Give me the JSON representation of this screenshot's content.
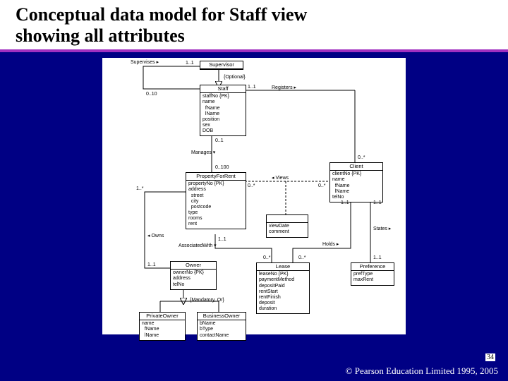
{
  "title_line1": "Conceptual data model for Staff view",
  "title_line2": "showing all attributes",
  "page_number": "34",
  "copyright": "© Pearson Education Limited 1995, 2005",
  "entities": {
    "supervisor": {
      "name": "Supervisor"
    },
    "staff": {
      "name": "Staff",
      "attrs": "staffNo {PK}\nname\n  fName\n  lName\nposition\nsex\nDOB"
    },
    "property": {
      "name": "PropertyForRent",
      "attrs": "propertyNo {PK}\naddress\n  street\n  city\n  postcode\ntype\nrooms\nrent"
    },
    "client": {
      "name": "Client",
      "attrs": "clientNo {PK}\nname\n  fName\n  lName\ntelNo"
    },
    "viewing": {
      "name": "",
      "attrs": "viewDate\ncomment"
    },
    "owner": {
      "name": "Owner",
      "attrs": "ownerNo {PK}\naddress\ntelNo"
    },
    "lease": {
      "name": "Lease",
      "attrs": "leaseNo {PK}\npaymentMethod\ndepositPaid\nrentStart\nrentFinish\ndeposit\nduration"
    },
    "preference": {
      "name": "Preference",
      "attrs": "prefType\nmaxRent"
    },
    "private": {
      "name": "PrivateOwner",
      "attrs": "name\n  fName\n  lName"
    },
    "business": {
      "name": "BusinessOwner",
      "attrs": "bName\nbType\ncontactName"
    }
  },
  "labels": {
    "supervises": "Supervises ▸",
    "optional": "{Optional}",
    "registers": "Registers ▸",
    "manages": "Manages ▾",
    "views": "◂ Views",
    "owns": "◂ Owns",
    "associated": "AssociatedWith ▾",
    "holds": "Holds ▸",
    "states": "States ▸",
    "mandatory": "{Mandatory, Or}",
    "m_0_10": "0..10",
    "m_1_1": "1..1",
    "m_0_1": "0..1",
    "m_0_100": "0..100",
    "m_0_s": "0..*",
    "m_1_s": "1..*"
  }
}
